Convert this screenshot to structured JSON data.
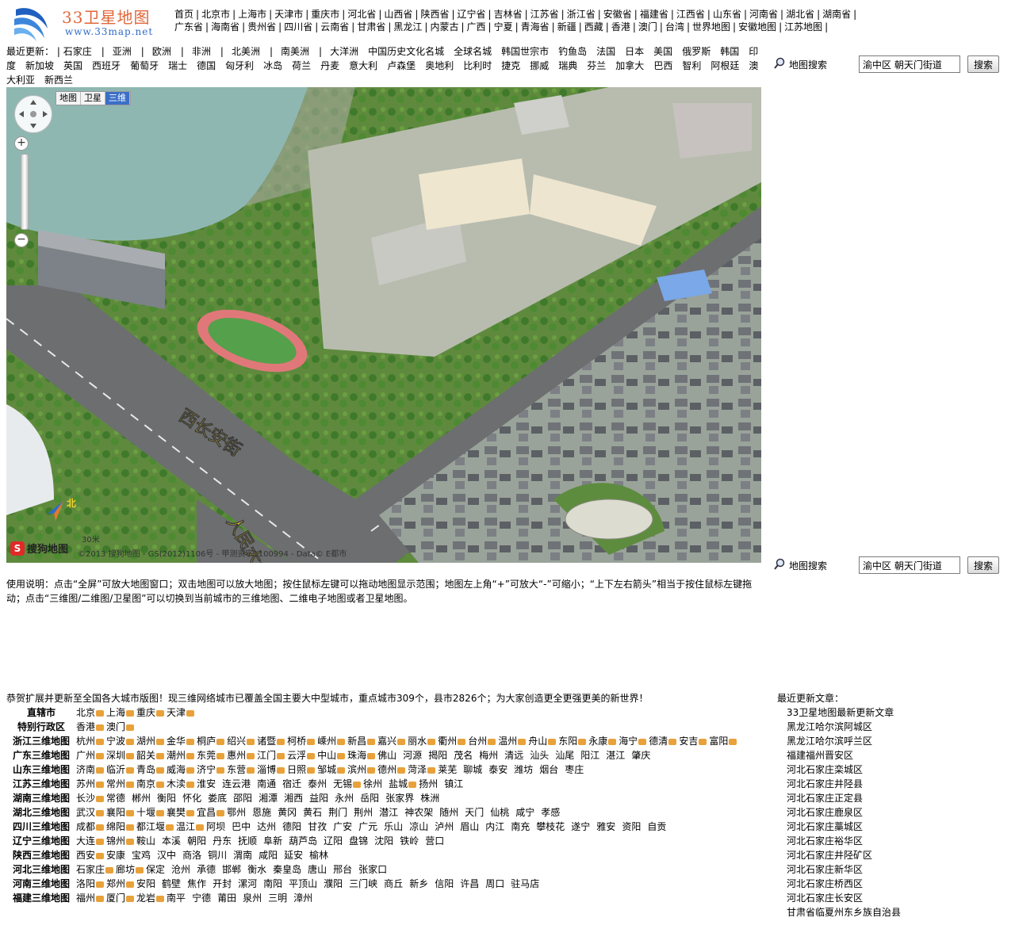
{
  "logo": {
    "title": "33卫星地图",
    "url": "www.33map.net"
  },
  "top_nav": [
    "首页",
    "北京市",
    "上海市",
    "天津市",
    "重庆市",
    "河北省",
    "山西省",
    "陕西省",
    "辽宁省",
    "吉林省",
    "江苏省",
    "浙江省",
    "安徽省",
    "福建省",
    "江西省",
    "山东省",
    "河南省",
    "湖北省",
    "湖南省",
    "广东省",
    "海南省",
    "贵州省",
    "四川省",
    "云南省",
    "甘肃省",
    "黑龙江",
    "内蒙古",
    "广西",
    "宁夏",
    "青海省",
    "新疆",
    "西藏",
    "香港",
    "澳门",
    "台湾",
    "世界地图",
    "安徽地图",
    "江苏地图"
  ],
  "updates": {
    "label": "最近更新：",
    "items": [
      "石家庄",
      "亚洲",
      "欧洲",
      "非洲",
      "北美洲",
      "南美洲",
      "大洋洲",
      "中国历史文化名城",
      "全球名城",
      "韩国世宗市",
      "钓鱼岛",
      "法国",
      "日本",
      "美国",
      "俄罗斯",
      "韩国",
      "印度",
      "新加坡",
      "英国",
      "西班牙",
      "葡萄牙",
      "瑞士",
      "德国",
      "匈牙利",
      "冰岛",
      "荷兰",
      "丹麦",
      "意大利",
      "卢森堡",
      "奥地利",
      "比利时",
      "捷克",
      "挪威",
      "瑞典",
      "芬兰",
      "加拿大",
      "巴西",
      "智利",
      "阿根廷",
      "澳大利亚",
      "新西兰"
    ]
  },
  "search": {
    "label": "地图搜索",
    "value": "渝中区 朝天门街道",
    "button": "搜索"
  },
  "map": {
    "modes": [
      "地图",
      "卫星",
      "三维"
    ],
    "active_mode": "三维",
    "street_1": "西长安街",
    "street_2": "人民大会堂",
    "compass": "北",
    "brand": "搜狗地图",
    "scale": "30米",
    "copyright": "©2013 搜狗地图 - GS(2012)1106号 - 甲测资字1100994 - Data© E都市"
  },
  "usage": "使用说明：点击“全屏”可放大地图窗口；双击地图可以放大地图；按住鼠标左键可以拖动地图显示范围；地图左上角“+”可放大“-”可缩小；“上下左右箭头”相当于按住鼠标左键拖动；点击“三维图/二维图/卫星图”可以切换到当前城市的三维地图、二维电子地图或者卫星地图。",
  "announcement": "恭贺扩展并更新至全国各大城市版图！现三维网络城市已覆盖全国主要大中型城市，重点城市309个，县市2826个；为大家创造更全更强更美的新世界！",
  "city_rows": [
    {
      "label": "直辖市",
      "cities": [
        {
          "n": "北京",
          "m": true
        },
        {
          "n": "上海",
          "m": true
        },
        {
          "n": "重庆",
          "m": true
        },
        {
          "n": "天津",
          "m": true
        }
      ]
    },
    {
      "label": "特别行政区",
      "cities": [
        {
          "n": "香港",
          "m": true
        },
        {
          "n": "澳门",
          "m": true
        }
      ]
    },
    {
      "label": "浙江三维地图",
      "cities": [
        {
          "n": "杭州",
          "m": true
        },
        {
          "n": "宁波",
          "m": true
        },
        {
          "n": "湖州",
          "m": true
        },
        {
          "n": "金华",
          "m": true
        },
        {
          "n": "桐庐",
          "m": true
        },
        {
          "n": "绍兴",
          "m": true
        },
        {
          "n": "诸暨",
          "m": true
        },
        {
          "n": "柯桥",
          "m": true
        },
        {
          "n": "嵊州",
          "m": true
        },
        {
          "n": "新昌",
          "m": true
        },
        {
          "n": "嘉兴",
          "m": true
        },
        {
          "n": "丽水",
          "m": true
        },
        {
          "n": "衢州",
          "m": true
        },
        {
          "n": "台州",
          "m": true
        },
        {
          "n": "温州",
          "m": true
        },
        {
          "n": "舟山",
          "m": true
        },
        {
          "n": "东阳",
          "m": true
        },
        {
          "n": "永康",
          "m": true
        },
        {
          "n": "海宁",
          "m": true
        },
        {
          "n": "德清",
          "m": true
        },
        {
          "n": "安吉",
          "m": true
        },
        {
          "n": "富阳",
          "m": true
        }
      ]
    },
    {
      "label": "广东三维地图",
      "cities": [
        {
          "n": "广州",
          "m": true
        },
        {
          "n": "深圳",
          "m": true
        },
        {
          "n": "韶关",
          "m": true
        },
        {
          "n": "潮州",
          "m": true
        },
        {
          "n": "东莞",
          "m": true
        },
        {
          "n": "惠州",
          "m": true
        },
        {
          "n": "江门",
          "m": true
        },
        {
          "n": "云浮",
          "m": true
        },
        {
          "n": "中山",
          "m": true
        },
        {
          "n": "珠海",
          "m": true
        },
        {
          "n": "佛山",
          "m": false
        },
        {
          "n": "河源",
          "m": false
        },
        {
          "n": "揭阳",
          "m": false
        },
        {
          "n": "茂名",
          "m": false
        },
        {
          "n": "梅州",
          "m": false
        },
        {
          "n": "清远",
          "m": false
        },
        {
          "n": "汕头",
          "m": false
        },
        {
          "n": "汕尾",
          "m": false
        },
        {
          "n": "阳江",
          "m": false
        },
        {
          "n": "湛江",
          "m": false
        },
        {
          "n": "肇庆",
          "m": false
        }
      ]
    },
    {
      "label": "山东三维地图",
      "cities": [
        {
          "n": "济南",
          "m": true
        },
        {
          "n": "临沂",
          "m": true
        },
        {
          "n": "青岛",
          "m": true
        },
        {
          "n": "威海",
          "m": true
        },
        {
          "n": "济宁",
          "m": true
        },
        {
          "n": "东营",
          "m": true
        },
        {
          "n": "淄博",
          "m": true
        },
        {
          "n": "日照",
          "m": true
        },
        {
          "n": "邹城",
          "m": true
        },
        {
          "n": "滨州",
          "m": true
        },
        {
          "n": "德州",
          "m": true
        },
        {
          "n": "菏泽",
          "m": true
        },
        {
          "n": "莱芜",
          "m": false
        },
        {
          "n": "聊城",
          "m": false
        },
        {
          "n": "泰安",
          "m": false
        },
        {
          "n": "潍坊",
          "m": false
        },
        {
          "n": "烟台",
          "m": false
        },
        {
          "n": "枣庄",
          "m": false
        }
      ]
    },
    {
      "label": "江苏三维地图",
      "cities": [
        {
          "n": "苏州",
          "m": true
        },
        {
          "n": "常州",
          "m": true
        },
        {
          "n": "南京",
          "m": true
        },
        {
          "n": "木渎",
          "m": true
        },
        {
          "n": "淮安",
          "m": false
        },
        {
          "n": "连云港",
          "m": false
        },
        {
          "n": "南通",
          "m": false
        },
        {
          "n": "宿迁",
          "m": false
        },
        {
          "n": "泰州",
          "m": false
        },
        {
          "n": "无锡",
          "m": true
        },
        {
          "n": "徐州",
          "m": false
        },
        {
          "n": "盐城",
          "m": true
        },
        {
          "n": "扬州",
          "m": false
        },
        {
          "n": "镇江",
          "m": false
        }
      ]
    },
    {
      "label": "湖南三维地图",
      "cities": [
        {
          "n": "长沙",
          "m": true
        },
        {
          "n": "常德",
          "m": false
        },
        {
          "n": "郴州",
          "m": false
        },
        {
          "n": "衡阳",
          "m": false
        },
        {
          "n": "怀化",
          "m": false
        },
        {
          "n": "娄底",
          "m": false
        },
        {
          "n": "邵阳",
          "m": false
        },
        {
          "n": "湘潭",
          "m": false
        },
        {
          "n": "湘西",
          "m": false
        },
        {
          "n": "益阳",
          "m": false
        },
        {
          "n": "永州",
          "m": false
        },
        {
          "n": "岳阳",
          "m": false
        },
        {
          "n": "张家界",
          "m": false
        },
        {
          "n": "株洲",
          "m": false
        }
      ]
    },
    {
      "label": "湖北三维地图",
      "cities": [
        {
          "n": "武汉",
          "m": true
        },
        {
          "n": "襄阳",
          "m": true
        },
        {
          "n": "十堰",
          "m": true
        },
        {
          "n": "襄樊",
          "m": true
        },
        {
          "n": "宜昌",
          "m": true
        },
        {
          "n": "鄂州",
          "m": false
        },
        {
          "n": "恩施",
          "m": false
        },
        {
          "n": "黄冈",
          "m": false
        },
        {
          "n": "黄石",
          "m": false
        },
        {
          "n": "荆门",
          "m": false
        },
        {
          "n": "荆州",
          "m": false
        },
        {
          "n": "潜江",
          "m": false
        },
        {
          "n": "神农架",
          "m": false
        },
        {
          "n": "随州",
          "m": false
        },
        {
          "n": "天门",
          "m": false
        },
        {
          "n": "仙桃",
          "m": false
        },
        {
          "n": "咸宁",
          "m": false
        },
        {
          "n": "孝感",
          "m": false
        }
      ]
    },
    {
      "label": "四川三维地图",
      "cities": [
        {
          "n": "成都",
          "m": true
        },
        {
          "n": "绵阳",
          "m": true
        },
        {
          "n": "都江堰",
          "m": true
        },
        {
          "n": "温江",
          "m": true
        },
        {
          "n": "阿坝",
          "m": false
        },
        {
          "n": "巴中",
          "m": false
        },
        {
          "n": "达州",
          "m": false
        },
        {
          "n": "德阳",
          "m": false
        },
        {
          "n": "甘孜",
          "m": false
        },
        {
          "n": "广安",
          "m": false
        },
        {
          "n": "广元",
          "m": false
        },
        {
          "n": "乐山",
          "m": false
        },
        {
          "n": "凉山",
          "m": false
        },
        {
          "n": "泸州",
          "m": false
        },
        {
          "n": "眉山",
          "m": false
        },
        {
          "n": "内江",
          "m": false
        },
        {
          "n": "南充",
          "m": false
        },
        {
          "n": "攀枝花",
          "m": false
        },
        {
          "n": "遂宁",
          "m": false
        },
        {
          "n": "雅安",
          "m": false
        },
        {
          "n": "资阳",
          "m": false
        },
        {
          "n": "自贡",
          "m": false
        }
      ]
    },
    {
      "label": "辽宁三维地图",
      "cities": [
        {
          "n": "大连",
          "m": true
        },
        {
          "n": "锦州",
          "m": true
        },
        {
          "n": "鞍山",
          "m": false
        },
        {
          "n": "本溪",
          "m": false
        },
        {
          "n": "朝阳",
          "m": false
        },
        {
          "n": "丹东",
          "m": false
        },
        {
          "n": "抚顺",
          "m": false
        },
        {
          "n": "阜新",
          "m": false
        },
        {
          "n": "葫芦岛",
          "m": false
        },
        {
          "n": "辽阳",
          "m": false
        },
        {
          "n": "盘锦",
          "m": false
        },
        {
          "n": "沈阳",
          "m": false
        },
        {
          "n": "铁岭",
          "m": false
        },
        {
          "n": "营口",
          "m": false
        }
      ]
    },
    {
      "label": "陕西三维地图",
      "cities": [
        {
          "n": "西安",
          "m": true
        },
        {
          "n": "安康",
          "m": false
        },
        {
          "n": "宝鸡",
          "m": false
        },
        {
          "n": "汉中",
          "m": false
        },
        {
          "n": "商洛",
          "m": false
        },
        {
          "n": "铜川",
          "m": false
        },
        {
          "n": "渭南",
          "m": false
        },
        {
          "n": "咸阳",
          "m": false
        },
        {
          "n": "延安",
          "m": false
        },
        {
          "n": "榆林",
          "m": false
        }
      ]
    },
    {
      "label": "河北三维地图",
      "cities": [
        {
          "n": "石家庄",
          "m": true
        },
        {
          "n": "廊坊",
          "m": true
        },
        {
          "n": "保定",
          "m": false
        },
        {
          "n": "沧州",
          "m": false
        },
        {
          "n": "承德",
          "m": false
        },
        {
          "n": "邯郸",
          "m": false
        },
        {
          "n": "衡水",
          "m": false
        },
        {
          "n": "秦皇岛",
          "m": false
        },
        {
          "n": "唐山",
          "m": false
        },
        {
          "n": "邢台",
          "m": false
        },
        {
          "n": "张家口",
          "m": false
        }
      ]
    },
    {
      "label": "河南三维地图",
      "cities": [
        {
          "n": "洛阳",
          "m": true
        },
        {
          "n": "郑州",
          "m": true
        },
        {
          "n": "安阳",
          "m": false
        },
        {
          "n": "鹤壁",
          "m": false
        },
        {
          "n": "焦作",
          "m": false
        },
        {
          "n": "开封",
          "m": false
        },
        {
          "n": "漯河",
          "m": false
        },
        {
          "n": "南阳",
          "m": false
        },
        {
          "n": "平顶山",
          "m": false
        },
        {
          "n": "濮阳",
          "m": false
        },
        {
          "n": "三门峡",
          "m": false
        },
        {
          "n": "商丘",
          "m": false
        },
        {
          "n": "新乡",
          "m": false
        },
        {
          "n": "信阳",
          "m": false
        },
        {
          "n": "许昌",
          "m": false
        },
        {
          "n": "周口",
          "m": false
        },
        {
          "n": "驻马店",
          "m": false
        }
      ]
    },
    {
      "label": "福建三维地图",
      "cities": [
        {
          "n": "福州",
          "m": true
        },
        {
          "n": "厦门",
          "m": true
        },
        {
          "n": "龙岩",
          "m": true
        },
        {
          "n": "南平",
          "m": false
        },
        {
          "n": "宁德",
          "m": false
        },
        {
          "n": "莆田",
          "m": false
        },
        {
          "n": "泉州",
          "m": false
        },
        {
          "n": "三明",
          "m": false
        },
        {
          "n": "漳州",
          "m": false
        }
      ]
    }
  ],
  "articles": {
    "label": "最近更新文章：",
    "items": [
      "33卫星地图最新更新文章",
      "黑龙江哈尔滨阿城区",
      "黑龙江哈尔滨呼兰区",
      "福建福州晋安区",
      "河北石家庄栾城区",
      "河北石家庄井陉县",
      "河北石家庄正定县",
      "河北石家庄鹿泉区",
      "河北石家庄藁城区",
      "河北石家庄裕华区",
      "河北石家庄井陉矿区",
      "河北石家庄新华区",
      "河北石家庄桥西区",
      "河北石家庄长安区",
      "甘肃省临夏州东乡族自治县"
    ]
  }
}
